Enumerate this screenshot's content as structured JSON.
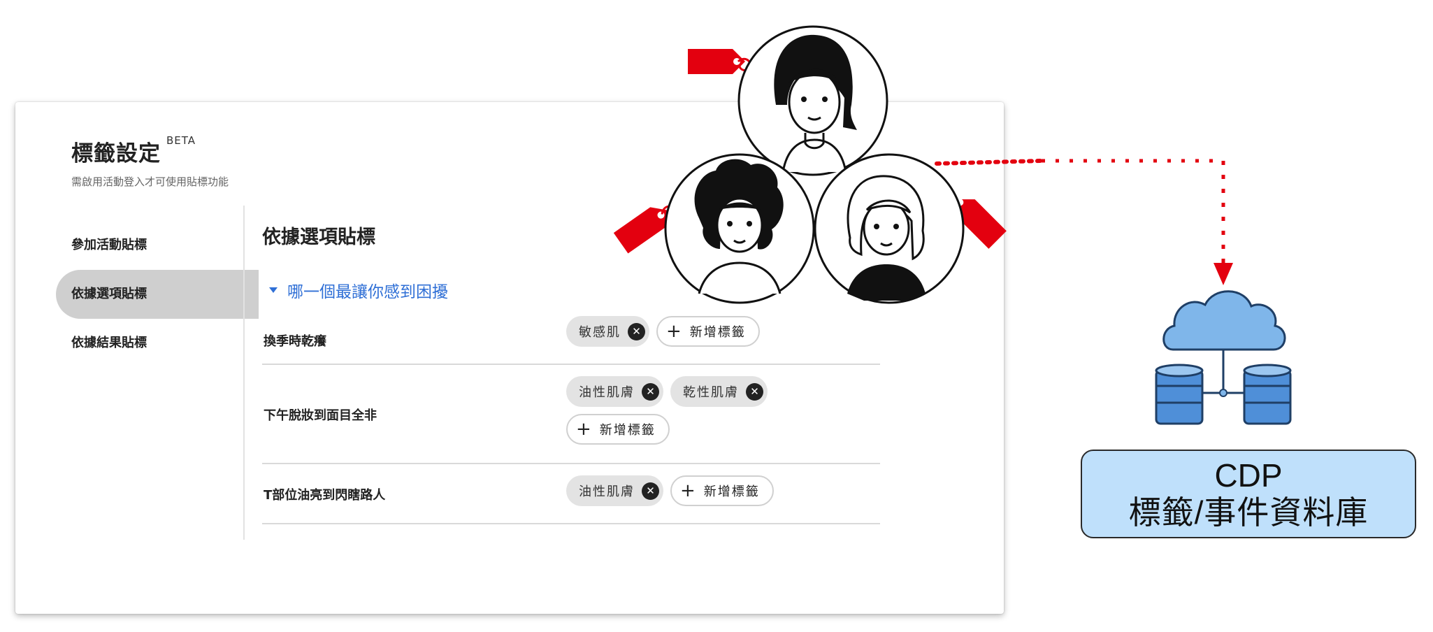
{
  "header": {
    "title": "標籤設定",
    "badge": "BETA",
    "subtitle": "需啟用活動登入才可使用貼標功能"
  },
  "sidebar": {
    "items": [
      {
        "label": "參加活動貼標",
        "active": false
      },
      {
        "label": "依據選項貼標",
        "active": true
      },
      {
        "label": "依據結果貼標",
        "active": false
      }
    ]
  },
  "main": {
    "section_title": "依據選項貼標",
    "question": "哪一個最讓你感到困擾",
    "rows": [
      {
        "label": "換季時乾癢",
        "tags": [
          "敏感肌"
        ],
        "add_label": "新增標籤"
      },
      {
        "label": "下午脫妝到面目全非",
        "tags": [
          "油性肌膚",
          "乾性肌膚"
        ],
        "add_label": "新增標籤"
      },
      {
        "label": "T部位油亮到閃瞎路人",
        "tags": [
          "油性肌膚"
        ],
        "add_label": "新增標籤"
      }
    ]
  },
  "illustration": {
    "people_count": 3,
    "tag_color": "#e3000f",
    "cloud_color": "#7fb6ea",
    "database_color": "#4f8fd8",
    "cdp_line1": "CDP",
    "cdp_line2": "標籤/事件資料庫",
    "cdp_box_color": "#bfe0fb"
  },
  "colors": {
    "accent_blue": "#2f6fd6",
    "active_nav_bg": "#cfcfcf",
    "chip_bg": "#e3e3e3"
  }
}
